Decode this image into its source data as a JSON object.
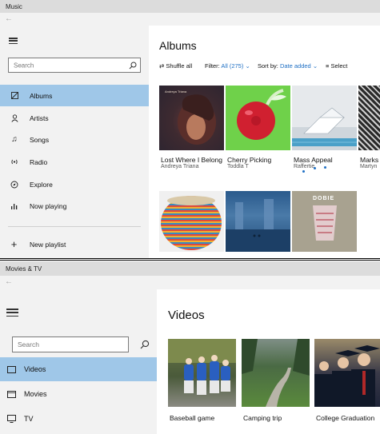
{
  "music": {
    "window_title": "Music",
    "search_placeholder": "Search",
    "nav": [
      {
        "label": "Albums",
        "icon": "album-icon",
        "selected": true
      },
      {
        "label": "Artists",
        "icon": "person-icon"
      },
      {
        "label": "Songs",
        "icon": "note-icon"
      },
      {
        "label": "Radio",
        "icon": "radio-icon"
      },
      {
        "label": "Explore",
        "icon": "explore-icon"
      },
      {
        "label": "Now playing",
        "icon": "equalizer-icon"
      }
    ],
    "new_playlist": "New playlist",
    "page_title": "Albums",
    "toolbar": {
      "shuffle": "Shuffle all",
      "filter_label": "Filter:",
      "filter_value": "All (275)",
      "sort_label": "Sort by:",
      "sort_value": "Date added",
      "select": "Select"
    },
    "albums": [
      {
        "title": "Lost Where I Belong",
        "artist": "Andreya Triana",
        "art_text": "Andreya Triana"
      },
      {
        "title": "Cherry Picking",
        "artist": "Toddla T"
      },
      {
        "title": "Mass Appeal",
        "artist": "Raffertie"
      },
      {
        "title": "Marks",
        "artist": "Martyn"
      },
      {
        "title": "",
        "artist": ""
      },
      {
        "title": "",
        "artist": ""
      },
      {
        "title": "",
        "artist": "",
        "art_text": "DOBIE"
      }
    ],
    "accent_color": "#1e6fc4",
    "selected_color": "#9fc7e8"
  },
  "movies": {
    "window_title": "Movies & TV",
    "search_placeholder": "Search",
    "nav": [
      {
        "label": "Videos",
        "icon": "video-icon",
        "selected": true
      },
      {
        "label": "Movies",
        "icon": "movie-icon"
      },
      {
        "label": "TV",
        "icon": "tv-icon"
      }
    ],
    "page_title": "Videos",
    "videos": [
      {
        "title": "Baseball game"
      },
      {
        "title": "Camping trip"
      },
      {
        "title": "College Graduation"
      }
    ]
  }
}
